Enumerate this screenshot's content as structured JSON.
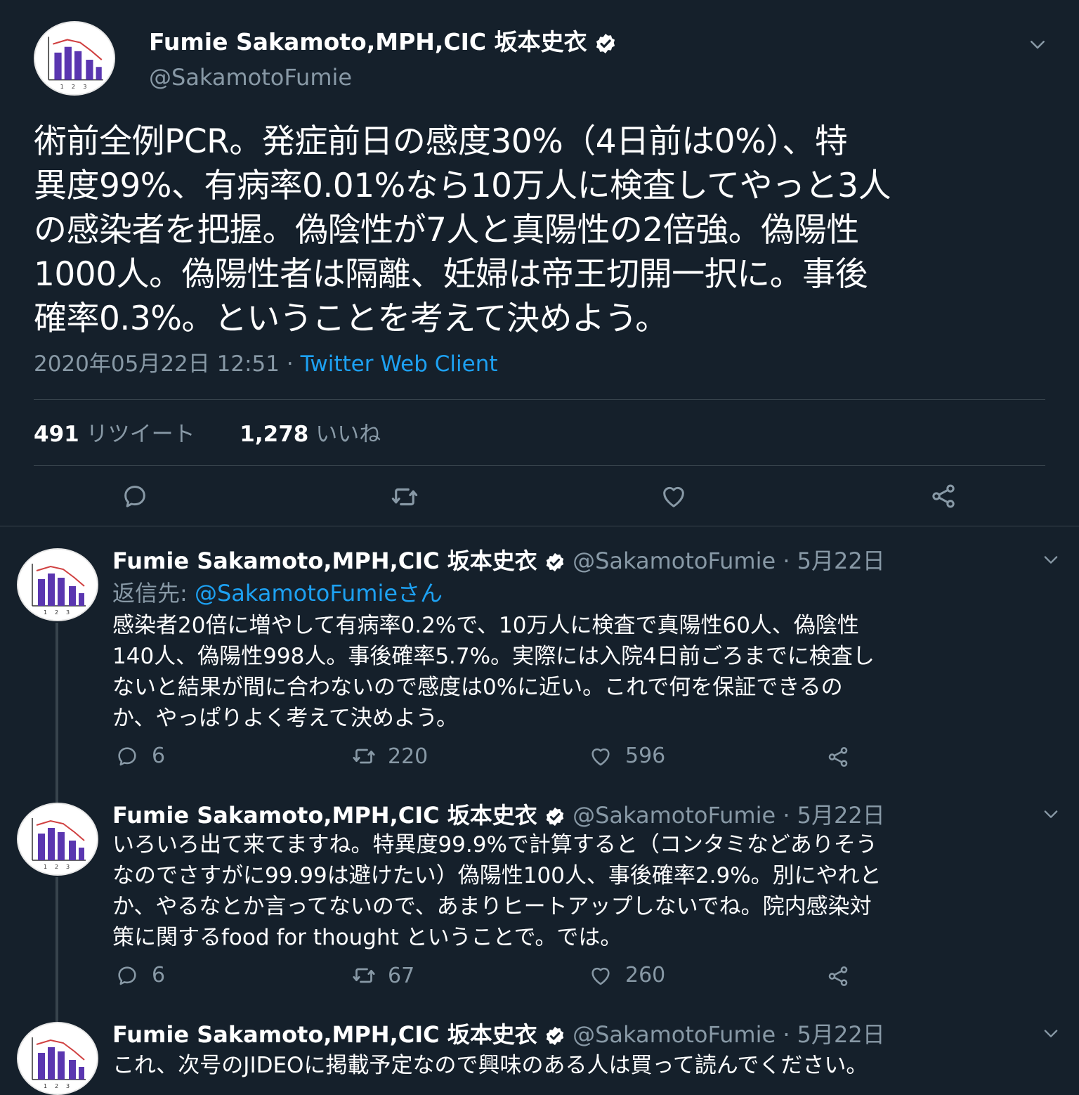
{
  "colors": {
    "background": "#15202b",
    "text": "#ffffff",
    "muted": "#8899a6",
    "link": "#1da1f2",
    "divider": "#38444d",
    "avatar_bar": "#5a36b0"
  },
  "main_tweet": {
    "display_name": "Fumie Sakamoto,MPH,CIC 坂本史衣",
    "handle": "@SakamotoFumie",
    "text_lines": [
      "術前全例PCR。発症前日の感度30%（4日前は0%）、特",
      "異度99%、有病率0.01%なら10万人に検査してやっと3人",
      "の感染者を把握。偽陰性が7人と真陽性の2倍強。偽陽性",
      "1000人。偽陽性者は隔離、妊婦は帝王切開一択に。事後",
      "確率0.3%。ということを考えて決めよう。"
    ],
    "timestamp": "2020年05月22日 12:51",
    "separator": "·",
    "client": "Twitter Web Client",
    "retweets_count": "491",
    "retweets_label": "リツイート",
    "likes_count": "1,278",
    "likes_label": "いいね"
  },
  "replies": [
    {
      "display_name": "Fumie Sakamoto,MPH,CIC 坂本史衣",
      "handle": "@SakamotoFumie",
      "date": "· 5月22日",
      "reply_to_label": "返信先:",
      "reply_to_handle": "@SakamotoFumieさん",
      "text_lines": [
        "感染者20倍に増やして有病率0.2%で、10万人に検査で真陽性60人、偽陰性",
        "140人、偽陽性998人。事後確率5.7%。実際には入院4日前ごろまでに検査し",
        "ないと結果が間に合わないので感度は0%に近い。これで何を保証できるの",
        "か、やっぱりよく考えて決めよう。"
      ],
      "replies_count": "6",
      "retweets_count": "220",
      "likes_count": "596"
    },
    {
      "display_name": "Fumie Sakamoto,MPH,CIC 坂本史衣",
      "handle": "@SakamotoFumie",
      "date": "· 5月22日",
      "text_lines": [
        "いろいろ出て来てますね。特異度99.9%で計算すると（コンタミなどありそう",
        "なのでさすがに99.99は避けたい）偽陽性100人、事後確率2.9%。別にやれと",
        "か、やるなとか言ってないので、あまりヒートアップしないでね。院内感染対",
        "策に関するfood for thought ということで。では。"
      ],
      "replies_count": "6",
      "retweets_count": "67",
      "likes_count": "260"
    },
    {
      "display_name": "Fumie Sakamoto,MPH,CIC 坂本史衣",
      "handle": "@SakamotoFumie",
      "date": "· 5月22日",
      "text_lines": [
        "これ、次号のJIDEOに掲載予定なので興味のある人は買って読んでください。"
      ]
    }
  ],
  "icons": {
    "reply": "reply-icon",
    "retweet": "retweet-icon",
    "like": "heart-icon",
    "share": "share-icon",
    "verified": "verified-badge-icon",
    "menu": "chevron-down-icon"
  }
}
